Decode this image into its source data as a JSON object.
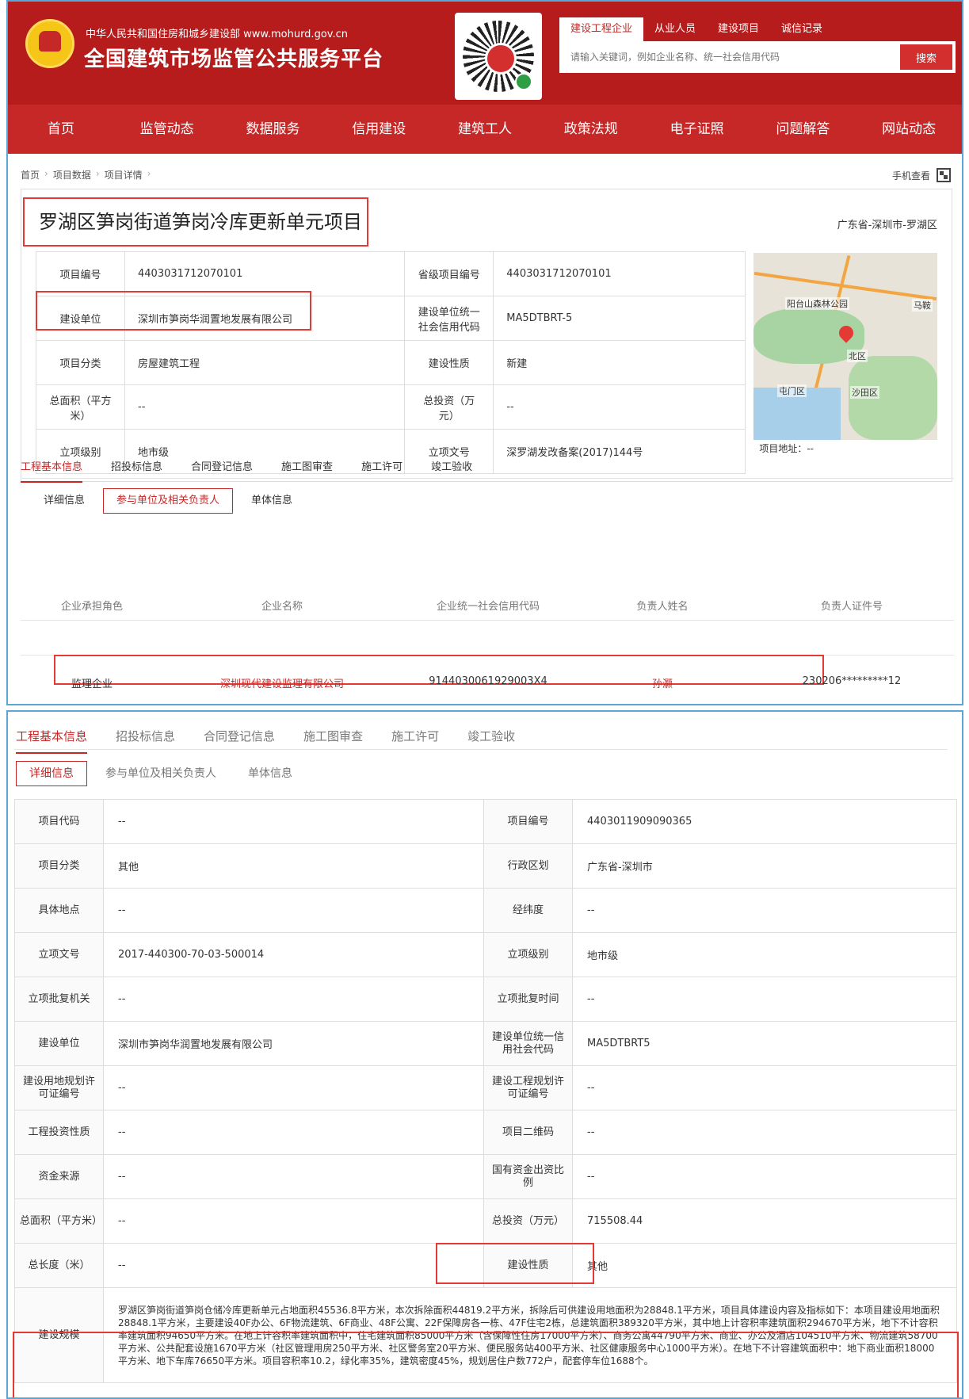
{
  "header": {
    "org": "中华人民共和国住房和城乡建设部  www.mohurd.gov.cn",
    "title": "全国建筑市场监管公共服务平台",
    "search_tabs": [
      "建设工程企业",
      "从业人员",
      "建设项目",
      "诚信记录"
    ],
    "search_placeholder": "请输入关键词，例如企业名称、统一社会信用代码",
    "search_button": "搜索"
  },
  "nav": [
    "首页",
    "监管动态",
    "数据服务",
    "信用建设",
    "建筑工人",
    "政策法规",
    "电子证照",
    "问题解答",
    "网站动态"
  ],
  "breadcrumb": [
    "首页",
    "项目数据",
    "项目详情"
  ],
  "mobile_view": "手机查看",
  "project": {
    "title": "罗湖区笋岗街道笋岗冷库更新单元项目",
    "region": "广东省-深圳市-罗湖区",
    "rows": [
      [
        "项目编号",
        "4403031712070101",
        "省级项目编号",
        "4403031712070101"
      ],
      [
        "建设单位",
        "深圳市笋岗华润置地发展有限公司",
        "建设单位统一社会信用代码",
        "MA5DTBRT-5"
      ],
      [
        "项目分类",
        "房屋建筑工程",
        "建设性质",
        "新建"
      ],
      [
        "总面积（平方米）",
        "--",
        "总投资（万元）",
        "--"
      ],
      [
        "立项级别",
        "地市级",
        "立项文号",
        "深罗湖发改备案(2017)144号"
      ]
    ],
    "address_label": "项目地址：--",
    "map_labels": [
      "阳台山森林公园",
      "北区",
      "屯门区",
      "沙田区",
      "马鞍"
    ]
  },
  "tabs": [
    "工程基本信息",
    "招投标信息",
    "合同登记信息",
    "施工图审查",
    "施工许可",
    "竣工验收"
  ],
  "subtabs": [
    "详细信息",
    "参与单位及相关负责人",
    "单体信息"
  ],
  "participants": {
    "headers": [
      "企业承担角色",
      "企业名称",
      "企业统一社会信用代码",
      "负责人姓名",
      "负责人证件号"
    ],
    "row": [
      "监理企业",
      "深圳现代建设监理有限公司",
      "9144030061929003X4",
      "孙灏",
      "230206*********12"
    ]
  },
  "detail": {
    "rows": [
      [
        "项目代码",
        "--",
        "项目编号",
        "4403011909090365"
      ],
      [
        "项目分类",
        "其他",
        "行政区划",
        "广东省-深圳市"
      ],
      [
        "具体地点",
        "--",
        "经纬度",
        "--"
      ],
      [
        "立项文号",
        "2017-440300-70-03-500014",
        "立项级别",
        "地市级"
      ],
      [
        "立项批复机关",
        "--",
        "立项批复时间",
        "--"
      ],
      [
        "建设单位",
        "深圳市笋岗华润置地发展有限公司",
        "建设单位统一信用社会代码",
        "MA5DTBRT5"
      ],
      [
        "建设用地规划许可证编号",
        "--",
        "建设工程规划许可证编号",
        "--"
      ],
      [
        "工程投资性质",
        "--",
        "项目二维码",
        "--"
      ],
      [
        "资金来源",
        "--",
        "国有资金出资比例",
        "--"
      ],
      [
        "总面积（平方米）",
        "--",
        "总投资（万元）",
        "715508.44"
      ],
      [
        "总长度（米）",
        "--",
        "建设性质",
        "其他"
      ]
    ],
    "scale_label": "建设规模",
    "scale_text": "罗湖区笋岗街道笋岗仓储冷库更新单元占地面积45536.8平方米，本次拆除面积44819.2平方米，拆除后可供建设用地面积为28848.1平方米，项目具体建设内容及指标如下：本项目建设用地面积28848.1平方米，主要建设40F办公、6F物流建筑、6F商业、48F公寓、22F保障房各一栋、47F住宅2栋，总建筑面积389320平方米，其中地上计容积率建筑面积294670平方米，地下不计容积率建筑面积94650平方米。在地上计容积率建筑面积中，住宅建筑面积85000平方米（含保障性住房17000平方米）、商务公寓44790平方米、商业、办公及酒店104510平方米、物流建筑58700平方米、公共配套设施1670平方米（社区管理用房250平方米、社区警务室20平方米、便民服务站400平方米、社区健康服务中心1000平方米）。在地下不计容建筑面积中：地下商业面积18000平方米、地下车库76650平方米。项目容积率10.2，绿化率35%，建筑密度45%，规划居住户数772户，配套停车位1688个。"
  }
}
